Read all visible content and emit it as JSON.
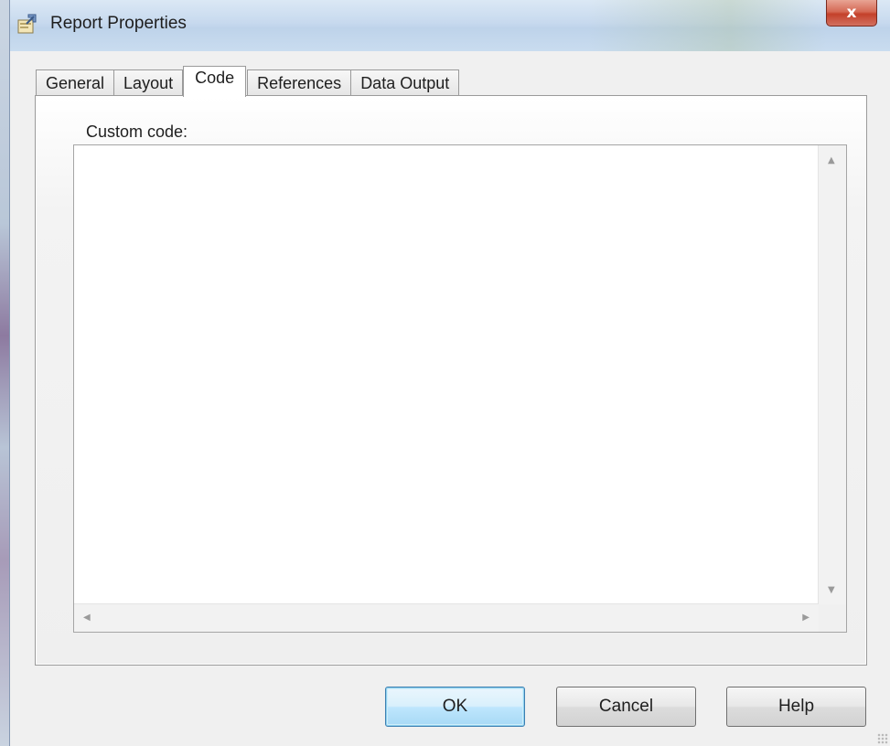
{
  "window": {
    "title": "Report Properties",
    "close_label": "x"
  },
  "tabs": [
    {
      "label": "General",
      "active": false
    },
    {
      "label": "Layout",
      "active": false
    },
    {
      "label": "Code",
      "active": true
    },
    {
      "label": "References",
      "active": false
    },
    {
      "label": "Data Output",
      "active": false
    }
  ],
  "code_tab": {
    "label": "Custom code:",
    "value": ""
  },
  "buttons": {
    "ok": "OK",
    "cancel": "Cancel",
    "help": "Help"
  },
  "icons": {
    "title": "report-properties-icon",
    "scroll_up": "▲",
    "scroll_down": "▼",
    "scroll_left": "◀",
    "scroll_right": "▶"
  },
  "colors": {
    "close_button": "#c4402a",
    "default_button_border": "#3c7fb1",
    "titlebar": "#c7d9ee"
  }
}
